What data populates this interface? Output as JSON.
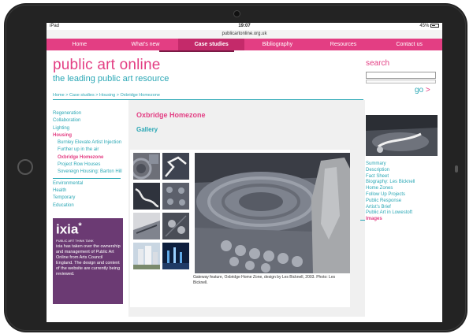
{
  "status_bar": {
    "carrier": "iPad",
    "time": "19:07",
    "battery": "45%"
  },
  "url": "publicartonline.org.uk",
  "nav": [
    "Home",
    "What's new",
    "Case studies",
    "Bibliography",
    "Resources",
    "Contact us"
  ],
  "site": {
    "title": "public art online",
    "subtitle": "the leading public art resource"
  },
  "search": {
    "label": "search",
    "go": "go",
    "go_arrow": ">"
  },
  "breadcrumb": "Home > Case studies > Housing > Oxbridge Homezone",
  "left_nav": {
    "group1": [
      "Regeneration",
      "Collaboration",
      "Lighting"
    ],
    "housing": "Housing",
    "housing_items": [
      "Burnley Elevate Artist Injection",
      "Further up in the air"
    ],
    "housing_active": "Oxbridge Homezone",
    "housing_items2": [
      "Project Row Houses",
      "Sovereign Housing: Barton Hill"
    ],
    "group2": [
      "Environmental",
      "Health",
      "Temporary",
      "Education"
    ]
  },
  "ixia": {
    "logo": "ixia",
    "logo_star": "*",
    "tagline": "PUBLIC ART THINK TANK",
    "text": "ixia has taken over the ownership and management of Public Art Online from Arts Council England. The design and content of the website are currently being reviewed."
  },
  "main": {
    "title": "Oxbridge Homezone",
    "section": "Gallery",
    "caption": "Gateway feature, Oxbridge Home Zone, design by Les Bicknell, 2003. Photo: Les Bicknell."
  },
  "right_nav": {
    "items": [
      "Summary",
      "Description",
      "Fact Sheet",
      "Biography: Les Bicknell",
      "Home Zones",
      "Follow Up Projects",
      "Public Response",
      "Artist's Brief",
      "Public Art in Lowestoft"
    ],
    "active": "Images"
  },
  "colors": {
    "brand_pink": "#e33e83",
    "teal": "#2aa7b5",
    "ixia_purple": "#6b3a73"
  },
  "icons": [
    "battery-icon",
    "right-arrow-icon"
  ]
}
